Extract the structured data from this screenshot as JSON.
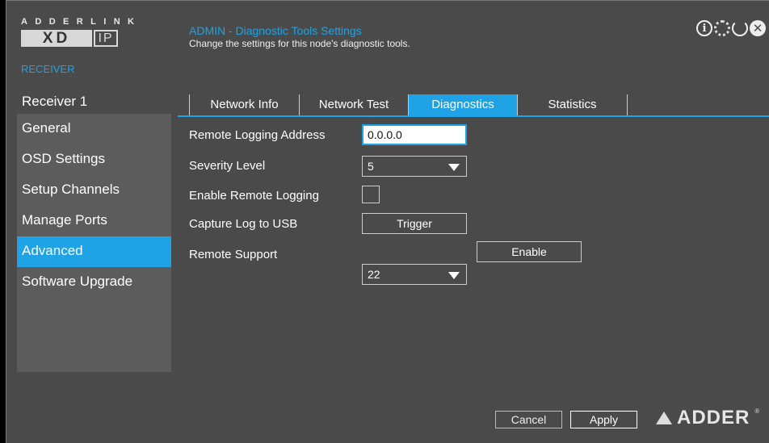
{
  "brand": {
    "company": "ADDERLINK",
    "product_main": "XD",
    "product_suffix": "IP",
    "role": "RECEIVER",
    "footer_logo": "ADDER",
    "registered_mark": "®"
  },
  "header": {
    "title": "ADMIN - Diagnostic Tools Settings",
    "subtitle": "Change the settings for this node's diagnostic tools.",
    "icons": [
      "info-icon",
      "gear-icon",
      "refresh-icon",
      "close-icon"
    ]
  },
  "sidebar": {
    "device_name": "Receiver 1",
    "items": [
      {
        "label": "General",
        "active": false
      },
      {
        "label": "OSD Settings",
        "active": false
      },
      {
        "label": "Setup Channels",
        "active": false
      },
      {
        "label": "Manage Ports",
        "active": false
      },
      {
        "label": "Advanced",
        "active": true
      },
      {
        "label": "Software Upgrade",
        "active": false
      }
    ]
  },
  "tabs": [
    {
      "label": "Network Info",
      "active": false
    },
    {
      "label": "Network Test",
      "active": false
    },
    {
      "label": "Diagnostics",
      "active": true
    },
    {
      "label": "Statistics",
      "active": false
    }
  ],
  "form": {
    "remote_logging_address": {
      "label": "Remote Logging Address",
      "value": "0.0.0.0"
    },
    "severity_level": {
      "label": "Severity Level",
      "value": "5"
    },
    "enable_remote_logging": {
      "label": "Enable Remote Logging",
      "checked": false
    },
    "capture_log": {
      "label": "Capture Log to USB",
      "button": "Trigger"
    },
    "remote_support": {
      "label": "Remote Support",
      "value": "22",
      "button": "Enable"
    }
  },
  "footer": {
    "cancel": "Cancel",
    "apply": "Apply"
  },
  "colors": {
    "accent": "#1fa3e6",
    "background": "#4a4a4a",
    "sidebar": "#5c5c5c"
  }
}
